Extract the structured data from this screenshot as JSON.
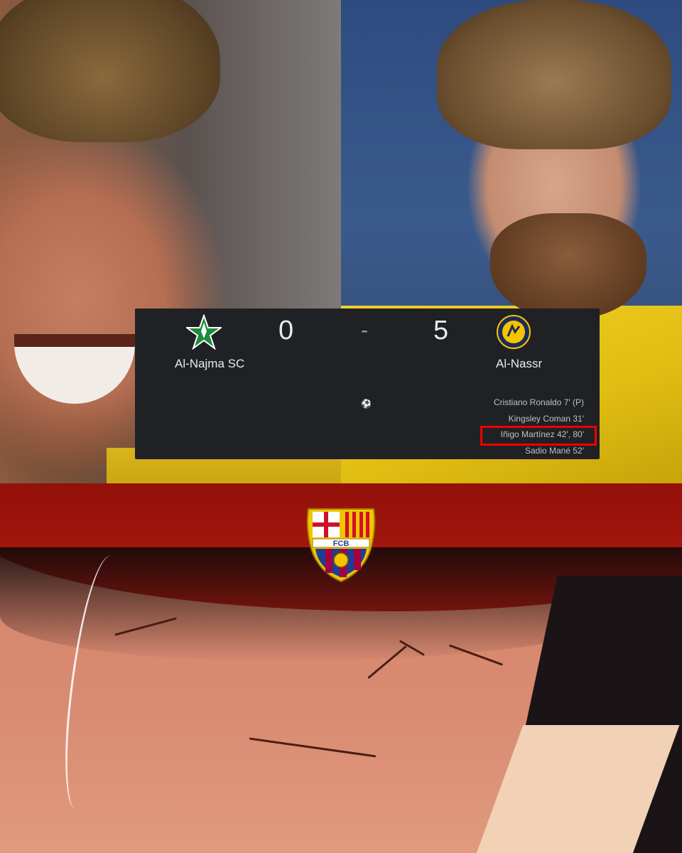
{
  "match": {
    "home_team": "Al-Najma SC",
    "away_team": "Al-Nassr",
    "home_score": "0",
    "away_score": "5",
    "separator": "-",
    "goal_icon": "soccer-ball-icon",
    "scorers": [
      "Cristiano Ronaldo 7' (P)",
      "Kingsley Coman 31'",
      "Iñigo Martínez 42', 80'",
      "Sadio Mané 52'"
    ],
    "highlighted_scorer_index": 2
  },
  "crest": {
    "text": "FCB",
    "icon": "fc-barcelona-crest-icon"
  },
  "colors": {
    "scoreboard_bg": "#202124",
    "highlight": "#f00000",
    "home_logo": "#1f8a3b",
    "away_logo": "#f2c500",
    "barca_blue": "#1c3f94",
    "barca_red": "#a50044"
  }
}
